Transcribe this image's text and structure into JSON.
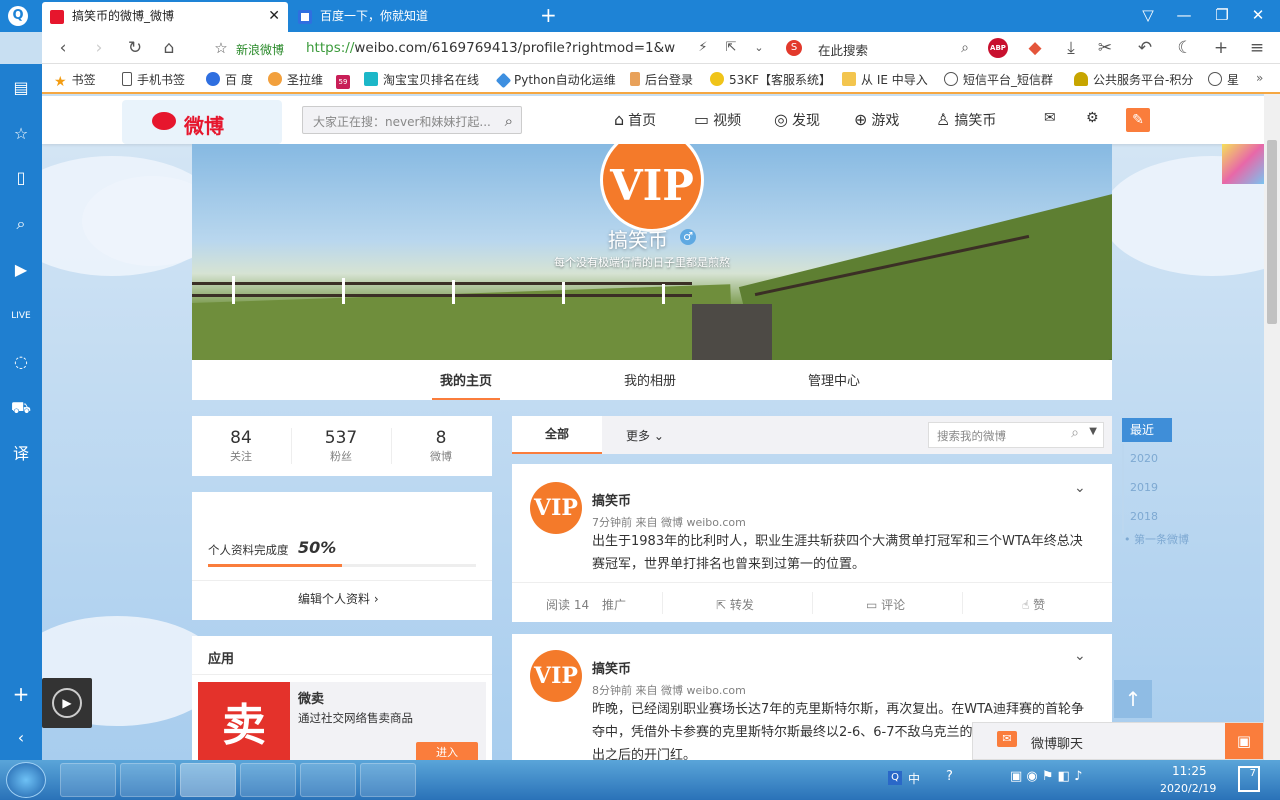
{
  "browser": {
    "tabs": [
      {
        "title": "搞笑币的微博_微博",
        "active": true
      },
      {
        "title": "百度一下，你就知道",
        "active": false
      }
    ],
    "new_tab": "+",
    "address": {
      "site_name": "新浪微博",
      "url_scheme": "https://",
      "url_domain": "weibo.com",
      "url_path": "/6169769413/profile?rightmod=1&w",
      "search_label": "在此搜索"
    },
    "bookmarks": [
      "书签",
      "手机书签",
      "百 度",
      "圣拉维",
      "淘宝宝贝排名在线",
      "Python自动化运维",
      "后台登录",
      "53KF【客服系统】",
      "从 IE 中导入",
      "短信平台_短信群",
      "公共服务平台-积分",
      "星"
    ],
    "bookmark_badge": "59"
  },
  "weibo": {
    "logo": "微博",
    "search_placeholder": "大家正在搜：never和妹妹打起...",
    "nav": [
      "首页",
      "视频",
      "发现",
      "游戏",
      "搞笑币"
    ],
    "profile": {
      "name": "搞笑币",
      "gender": "♂",
      "bio": "每个没有极端行情的日子里都是煎熬",
      "avatar_text": "VIP",
      "tabs": [
        "我的主页",
        "我的相册",
        "管理中心"
      ]
    },
    "stats": [
      {
        "num": "84",
        "label": "关注"
      },
      {
        "num": "537",
        "label": "粉丝"
      },
      {
        "num": "8",
        "label": "微博"
      }
    ],
    "completion": {
      "label": "个人资料完成度",
      "value": "50%",
      "fraction": 0.5,
      "edit": "编辑个人资料 ›"
    },
    "apps": {
      "title": "应用",
      "name": "微卖",
      "desc": "通过社交网络售卖商品",
      "enter": "进入",
      "icon_char": "卖"
    },
    "feed_tabs": {
      "all": "全部",
      "more": "更多",
      "search_placeholder": "搜索我的微博"
    },
    "timeline": {
      "recent": "最近",
      "years": [
        "2020",
        "2019",
        "2018"
      ],
      "first": "第一条微博"
    },
    "posts": [
      {
        "author": "搞笑币",
        "meta": "7分钟前 来自 微博 weibo.com",
        "text": "出生于1983年的比利时人，职业生涯共斩获四个大满贯单打冠军和三个WTA年终总决赛冠军，世界单打排名也曾来到过第一的位置。",
        "reads": "阅读 14",
        "promote": "推广",
        "repost": "转发",
        "comment": "评论",
        "like": "赞"
      },
      {
        "author": "搞笑币",
        "meta": "8分钟前 来自 微博 weibo.com",
        "text": "昨晚，已经阔别职业赛场长达7年的克里斯特尔斯，再次复出。在WTA迪拜赛的首轮争夺中，凭借外卡参赛的克里斯特尔斯最终以2-6、6-7不敌乌克兰的古鲁扎，无缘收获复出之后的开门红。"
      }
    ],
    "chat": "微博聊天"
  },
  "taskbar": {
    "ime": "中",
    "time": "11:25",
    "date": "2020/2/19",
    "notif": "7"
  },
  "colors": {
    "weibo_orange": "#fa7d3c",
    "weibo_red": "#e6162d",
    "browser_blue": "#1e83d6"
  }
}
